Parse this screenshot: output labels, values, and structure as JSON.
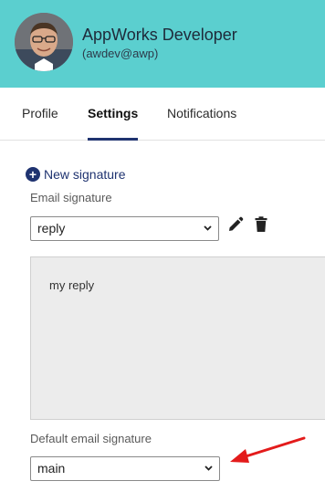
{
  "user": {
    "name": "AppWorks Developer",
    "handle": "(awdev@awp)"
  },
  "tabs": [
    {
      "label": "Profile",
      "active": false
    },
    {
      "label": "Settings",
      "active": true
    },
    {
      "label": "Notifications",
      "active": false
    }
  ],
  "settings": {
    "new_signature_label": "New signature",
    "email_signature_label": "Email signature",
    "email_signature_value": "reply",
    "signature_text": "my reply",
    "default_signature_label": "Default email signature",
    "default_signature_value": "main"
  },
  "colors": {
    "header_bg": "#5bcfcf",
    "accent": "#1f3370",
    "annotation_arrow": "#e31b1b"
  },
  "icons": [
    "plus-circle-icon",
    "pencil-icon",
    "trash-icon",
    "chevron-down-icon",
    "red-arrow-icon"
  ]
}
